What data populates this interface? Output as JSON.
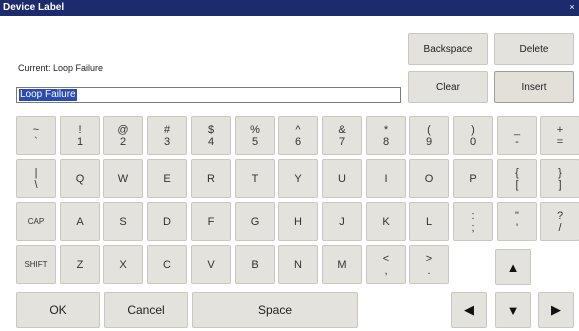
{
  "window": {
    "title": "Device Label",
    "close_glyph": "×"
  },
  "current": {
    "label": "Current: Loop Failure"
  },
  "input": {
    "value": "Loop Failure"
  },
  "edit_buttons": {
    "backspace": "Backspace",
    "delete": "Delete",
    "clear": "Clear",
    "insert": "Insert"
  },
  "rows": {
    "numbers": [
      {
        "top": "~",
        "bottom": "`"
      },
      {
        "top": "!",
        "bottom": "1"
      },
      {
        "top": "@",
        "bottom": "2"
      },
      {
        "top": "#",
        "bottom": "3"
      },
      {
        "top": "$",
        "bottom": "4"
      },
      {
        "top": "%",
        "bottom": "5"
      },
      {
        "top": "^",
        "bottom": "6"
      },
      {
        "top": "&",
        "bottom": "7"
      },
      {
        "top": "*",
        "bottom": "8"
      },
      {
        "top": "(",
        "bottom": "9"
      },
      {
        "top": ")",
        "bottom": "0"
      },
      {
        "top": "_",
        "bottom": "-"
      },
      {
        "top": "+",
        "bottom": "="
      }
    ],
    "qwerty": [
      {
        "top": "|",
        "bottom": "\\"
      },
      "Q",
      "W",
      "E",
      "R",
      "T",
      "Y",
      "U",
      "I",
      "O",
      "P",
      {
        "top": "{",
        "bottom": "["
      },
      {
        "top": "}",
        "bottom": "]"
      }
    ],
    "home": [
      "CAP",
      "A",
      "S",
      "D",
      "F",
      "G",
      "H",
      "J",
      "K",
      "L",
      {
        "top": ":",
        "bottom": ";"
      },
      {
        "top": "\"",
        "bottom": "'"
      },
      {
        "top": "?",
        "bottom": "/"
      }
    ],
    "bottom": [
      "SHIFT",
      "Z",
      "X",
      "C",
      "V",
      "B",
      "N",
      "M",
      {
        "top": "<",
        "bottom": ","
      },
      {
        "top": ">",
        "bottom": "."
      }
    ]
  },
  "actions": {
    "ok": "OK",
    "cancel": "Cancel",
    "space": "Space"
  },
  "arrows": {
    "up": "▲",
    "left": "◀",
    "down": "▼",
    "right": "▶"
  }
}
